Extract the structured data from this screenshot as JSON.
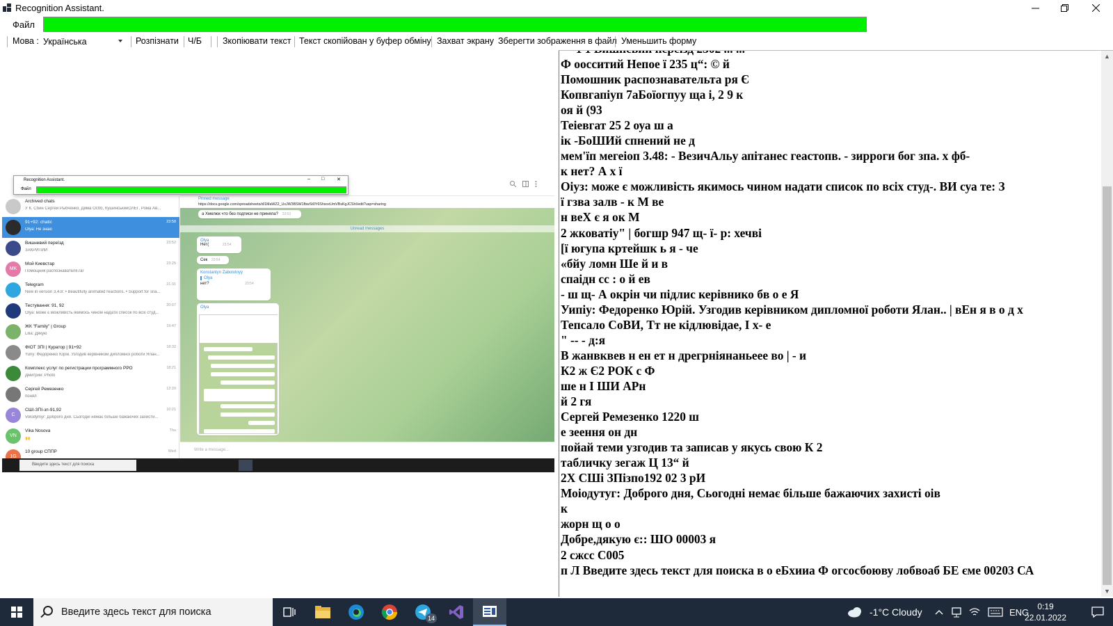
{
  "window": {
    "title": "Recognition Assistant.",
    "minimize_icon": "minimize-icon",
    "restore_icon": "restore-icon",
    "close_icon": "close-icon"
  },
  "menu": {
    "file_label": "Файл"
  },
  "progress": {
    "value_percent": 100,
    "color": "#00f000"
  },
  "toolbar": {
    "language_label": "Мова :",
    "language_value": "Українська",
    "recognize": "Розпізнати",
    "bw": "Ч/Б",
    "copy_text": "Зкопіювати текст",
    "copied_status": "Текст скопійован у буфер обміну",
    "screen_capture": "Захват экрану",
    "save_image": "Зберегти зображення в файл",
    "shrink_form": "Уменьшить форму"
  },
  "screenshot": {
    "mini_title": "Recognition Assistant.",
    "mini_file": "Файл",
    "pinned_label": "Pinned message",
    "pinned_url": "https://docs.google.com/spreadsheets/d/1MaWZ2_UxJW3BSW1fbwSt0Y6ShxoxUmVBsKgJCShI/edit?usp=sharing",
    "unread_label": "Unread messages",
    "compose_placeholder": "Write a message...",
    "taskbar_search": "Введите здесь текст для поиска",
    "chats": [
      {
        "name": "Archived chats",
        "sub": "У К. Сбин Сергей Рыбченко, Дима Осбб, КушинськийОЛЕГ, Рома Ав...",
        "time": "",
        "color": "#c9c9c9",
        "initials": ""
      },
      {
        "name": "91+92: chatic",
        "sub": "Olya: Не знаю",
        "time": "23:58",
        "color": "#2b2b2b",
        "initials": ""
      },
      {
        "name": "Вишневий переїзд",
        "sub": "ЗАКРИПИЙ",
        "time": "23:52",
        "color": "#3a4a8a",
        "initials": ""
      },
      {
        "name": "Мой Киевстар",
        "sub": "Помощник распознавателя.rar",
        "time": "23:25",
        "color": "#e57aa8",
        "initials": "MK"
      },
      {
        "name": "Telegram",
        "sub": "New in version 3.4.8: • Beautifully animated reactions. • Support for sna...",
        "time": "21:31",
        "color": "#2ea6e0",
        "initials": ""
      },
      {
        "name": "Тестування: 91, 92",
        "sub": "Olya: може є можливість якимось чином надати список по всіх студ...",
        "time": "20:07",
        "color": "#1f3a7a",
        "initials": ""
      },
      {
        "name": "ЖК \"Family\" | Group",
        "sub": "Lilia: Дякую",
        "time": "19:47",
        "color": "#7bb36a",
        "initials": ""
      },
      {
        "name": "ФІОТ ЗПІ | Куратор | 91+92",
        "sub": "Yuriy: Федоренко Юрій. Узгодив керівником дипломної роботи Ялан...",
        "time": "18:32",
        "color": "#8a8a8a",
        "initials": ""
      },
      {
        "name": "Комплекс услуг по регистрации программного РРО",
        "sub": "Дмитрий: Photo",
        "time": "18:21",
        "color": "#3a8a3a",
        "initials": ""
      },
      {
        "name": "Сергей Ремезенко",
        "sub": "понял",
        "time": "12:20",
        "color": "#777777",
        "initials": ""
      },
      {
        "name": "СШІ-ЗПІ-зп-91,92",
        "sub": "Volodymyr: Доброго дня. Сьогодні немає більше бажаючих захисти...",
        "time": "10:21",
        "color": "#9a86d8",
        "initials": "С"
      },
      {
        "name": "Vika Nosova",
        "sub": "🙌",
        "time": "Thu",
        "color": "#6cc26c",
        "initials": "VN"
      },
      {
        "name": "10 group СППР",
        "sub": "",
        "time": "Wed",
        "color": "#e8734a",
        "initials": "1G"
      }
    ],
    "bubbles": [
      {
        "sender": "",
        "text": "а Хмелюк что без подписи не приняла?",
        "time": "23:53"
      },
      {
        "sender": "Olya",
        "text": "Нет(",
        "time": "23:54"
      },
      {
        "sender": "",
        "text": "Сек",
        "time": "23:54"
      },
      {
        "sender": "Konstantyn Zabolotnyy",
        "text": "нет?",
        "time": "23:54"
      },
      {
        "sender": "Olya",
        "text": "",
        "time": ""
      }
    ]
  },
  "ocr": {
    "clipped_top": "— 1 1 Вишневий переїзд 2302 ... ...",
    "lines": [
      "Ф оосситий Непое ї 235 ц“: © й",
      "Помошник распознавательта ря Є",
      "Копвгапіуп 7аБоїогпуу ща і, 2 9 к",
      "оя й (93",
      "Теіевгат 25 2 оуа ш а",
      "ік -БоШИй спнений не д",
      "мем'їп мегеіоп 3.48: - ВезичАльу апітанес геастопв. - зирроги бог зпа. х фб-",
      "к нет? А х ї",
      "Оіуз: може є можливість якимось чином надати список по всіх студ-. ВИ суа те: З",
      "ї гзва залв - к М ве",
      "н веХ є я ок М",
      "2 жковатіу\" | богшр 947 щ- ї- р: хечві",
      "[ї югупа кртейшк ь я - че",
      "«бйу ломн Ше й и в",
      "спаідн сс : о й ев",
      "- ш щ- А окрін чи підлис керівнико бв о е Я",
      "Уипіу: Федоренко Юрій. Узгодив керівником дипломної роботи Ялан.. | вЕн я в о д х",
      "Тепсало СоВИ, Тт не кідлювідае, І х- е",
      "\" -- - д:я",
      "В жанвквев н ен ет н дрегрніянаньеее во | - и",
      "К2 ж Є2 РОК с Ф",
      "ше н І ШИ АРн",
      "й 2 гя",
      "Сергей Ремезенко 1220 ш",
      "е зеення он дн",
      "пойай теми узгодив та записав у якусь свою К 2",
      "табличку зегаж Ц 13“ й",
      "2Х СШі ЗПізпо192 02 3 рИ",
      "Моіодутуг: Доброго дня, Сьогодні немає більше бажаючих захисті оів",
      "к",
      "жорн щ о о",
      "Добре,дякую є:: ШО 00003 я",
      "2 сжсс С005",
      "п Л Введите здесь текст для поиска в о еБхииа Ф огсосбоюву лобвоаб БЕ єме 00203 СА"
    ]
  },
  "taskbar": {
    "search_placeholder": "Введите здесь текст для поиска",
    "telegram_badge": "14",
    "weather": "-1°C  Cloudy",
    "language": "ENG",
    "time": "0:19",
    "date": "22.01.2022",
    "icons": [
      "windows-start-icon",
      "search-icon",
      "task-view-icon",
      "file-explorer-icon",
      "edge-icon",
      "chrome-icon",
      "telegram-icon",
      "visual-studio-icon",
      "recognition-assistant-icon",
      "weather-cloud-icon",
      "chevron-up-icon",
      "network-icon",
      "wifi-icon",
      "keyboard-icon",
      "notifications-icon"
    ]
  }
}
